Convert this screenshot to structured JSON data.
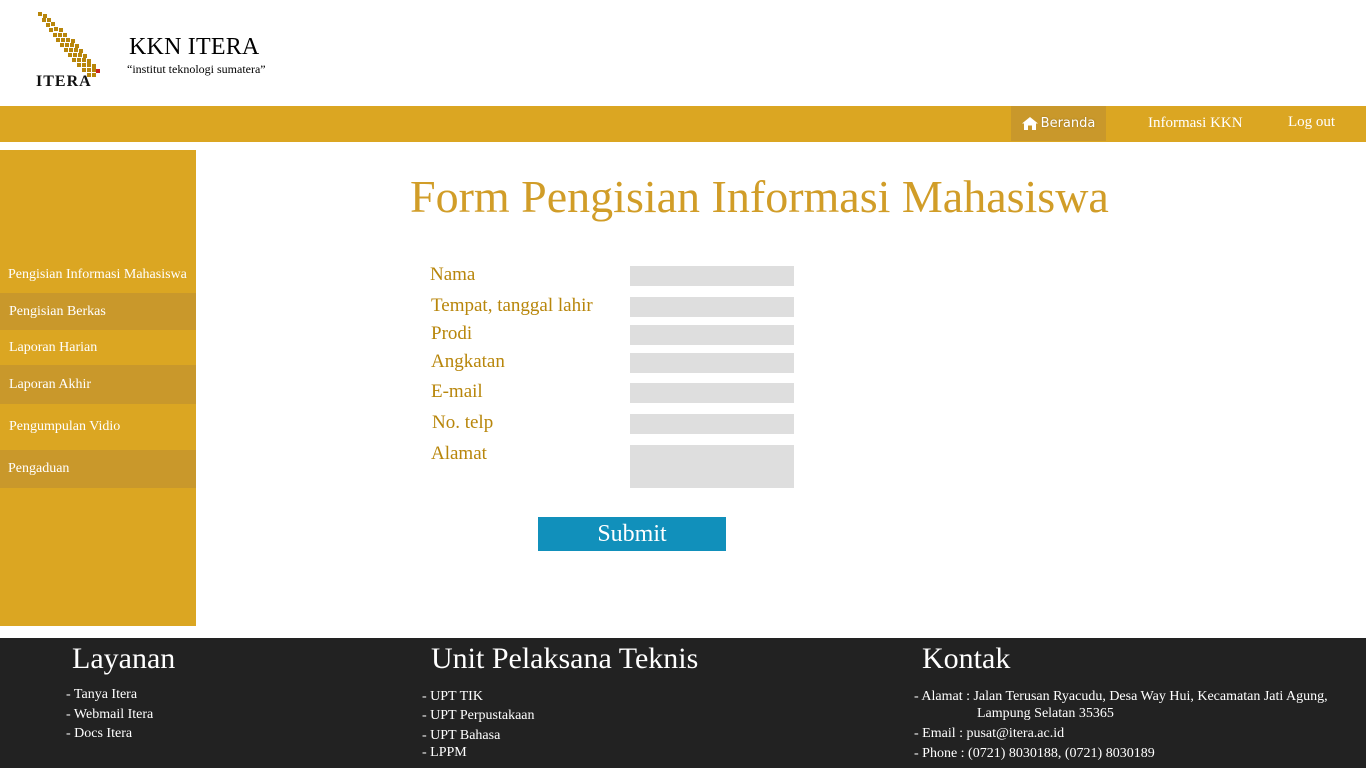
{
  "header": {
    "logo_text": "ITERA",
    "site_title": "KKN ITERA",
    "site_tagline": "“institut teknologi sumatera”"
  },
  "nav": {
    "home_label": "Beranda",
    "info_label": "Informasi KKN",
    "logout_label": "Log out"
  },
  "sidebar": {
    "items": [
      {
        "label": "Pengisian Informasi Mahasiswa"
      },
      {
        "label": "Pengisian Berkas"
      },
      {
        "label": "Laporan Harian"
      },
      {
        "label": "Laporan Akhir"
      },
      {
        "label": "Pengumpulan Vidio"
      },
      {
        "label": "Pengaduan"
      }
    ]
  },
  "form": {
    "title": "Form Pengisian Informasi Mahasiswa",
    "labels": {
      "nama": "Nama",
      "ttl": "Tempat, tanggal lahir",
      "prodi": "Prodi",
      "angkatan": "Angkatan",
      "email": "E-mail",
      "telp": "No. telp",
      "alamat": "Alamat"
    },
    "submit_label": "Submit"
  },
  "footer": {
    "layanan": {
      "heading": "Layanan",
      "links": [
        "- Tanya Itera",
        "- Webmail Itera",
        "- Docs Itera"
      ]
    },
    "upt": {
      "heading": "Unit Pelaksana Teknis",
      "links": [
        "- UPT TIK",
        "- UPT Perpustakaan",
        "- UPT Bahasa",
        "- LPPM"
      ]
    },
    "kontak": {
      "heading": "Kontak",
      "alamat_line1": "- Alamat : Jalan Terusan Ryacudu, Desa Way Hui, Kecamatan Jati Agung,",
      "alamat_line2": "Lampung Selatan 35365",
      "email": "- Email : pusat@itera.ac.id",
      "phone": "- Phone : (0721) 8030188, (0721) 8030189"
    }
  },
  "colors": {
    "brand_gold": "#DBA622",
    "brand_gold_dark": "#C9982B",
    "title_gold": "#D19D28",
    "submit_blue": "#1190BB",
    "footer_bg": "#222222"
  }
}
